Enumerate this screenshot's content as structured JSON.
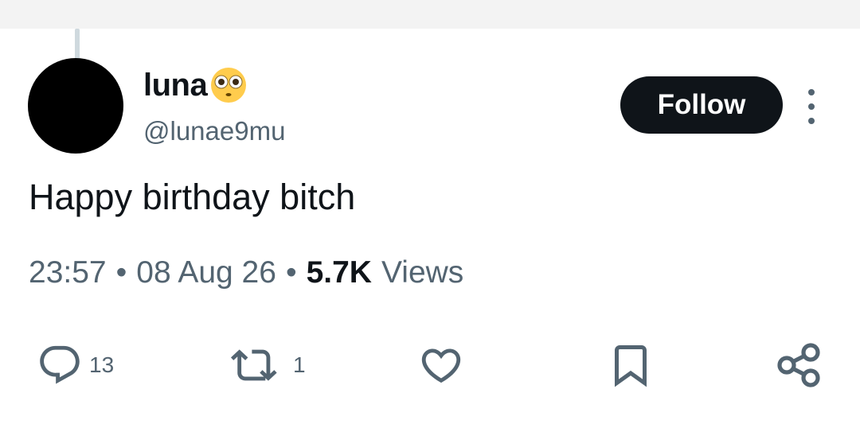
{
  "post": {
    "display_name": "luna",
    "display_name_emoji": "flushed-face-emoji",
    "handle": "@lunae9mu",
    "follow_label": "Follow",
    "text": "Happy birthday bitch",
    "time": "23:57",
    "separator": "•",
    "date": "08 Aug 26",
    "views_count": "5.7K",
    "views_label": "Views"
  },
  "actions": {
    "reply_count": "13",
    "retweet_count": "1"
  },
  "icons": {
    "avatar": "avatar",
    "more": "more-vertical-icon",
    "reply": "reply-icon",
    "retweet": "retweet-icon",
    "like": "heart-icon",
    "bookmark": "bookmark-icon",
    "share": "share-icon"
  },
  "colors": {
    "text": "#0f1419",
    "secondary": "#536471",
    "follow_bg": "#0f1419",
    "follow_text": "#ffffff",
    "avatar": "#000000"
  }
}
